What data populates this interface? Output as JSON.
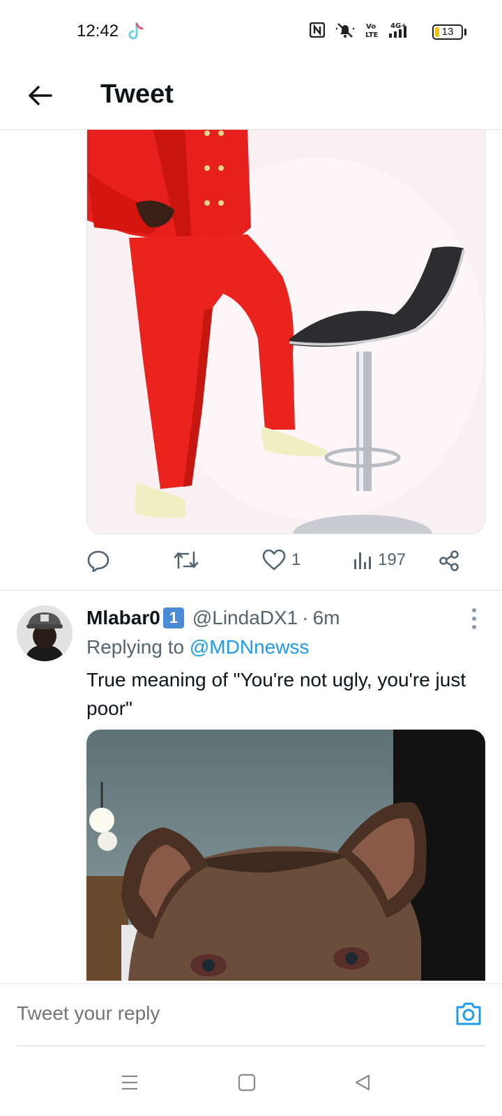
{
  "status_bar": {
    "time": "12:42",
    "battery": "13",
    "icons": [
      "tiktok-icon",
      "nfc-icon",
      "mute-icon",
      "volte-icon",
      "signal-4g-icon",
      "battery-icon"
    ]
  },
  "header": {
    "title": "Tweet",
    "back_icon": "arrow-left-icon"
  },
  "tweet": {
    "actions": {
      "reply_count": "",
      "retweet_count": "",
      "like_count": "1",
      "view_count": "197"
    }
  },
  "reply": {
    "display_name": "Mlabar0",
    "badge": "1",
    "handle": "@LindaDX1",
    "separator": "·",
    "time_ago": "6m",
    "replying_to_prefix": "Replying to",
    "replying_to_handle": "@MDNnewss",
    "text": "True meaning of \"You're not ugly, you're just poor\""
  },
  "composer": {
    "placeholder": "Tweet your reply"
  },
  "colors": {
    "accent": "#1d9bf0",
    "text_primary": "#0f1419",
    "text_secondary": "#536471"
  }
}
